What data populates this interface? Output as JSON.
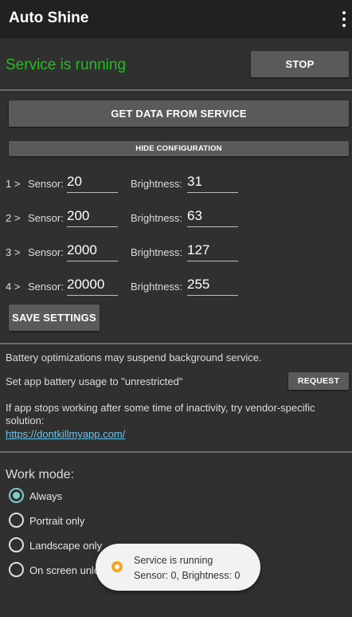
{
  "app_bar": {
    "title": "Auto Shine",
    "menu_icon": "overflow-menu-icon"
  },
  "service": {
    "status": "Service is running",
    "status_color": "#1fbf1f",
    "stop_label": "STOP"
  },
  "actions": {
    "get_data_label": "GET DATA FROM SERVICE",
    "hide_config_label": "HIDE CONFIGURATION",
    "save_label": "SAVE SETTINGS"
  },
  "config": {
    "sensor_label": "Sensor:",
    "brightness_label": "Brightness:",
    "rows": [
      {
        "index": "1 >",
        "sensor": "20",
        "brightness": "31"
      },
      {
        "index": "2 >",
        "sensor": "200",
        "brightness": "63"
      },
      {
        "index": "3 >",
        "sensor": "2000",
        "brightness": "127"
      },
      {
        "index": "4 >",
        "sensor": "20000",
        "brightness": "255"
      }
    ]
  },
  "battery": {
    "warning": "Battery optimizations may suspend background service.",
    "set_usage": "Set app battery usage to \"unrestricted\"",
    "request_label": "REQUEST",
    "vendor_hint": "If app stops working after some time of inactivity, try vendor-specific solution:",
    "link": "https://dontkillmyapp.com/"
  },
  "work_mode": {
    "title": "Work mode:",
    "options": [
      "Always",
      "Portrait only",
      "Landscape only",
      "On screen unlo"
    ],
    "selected": "Always"
  },
  "toast": {
    "line1": "Service is running",
    "line2": "Sensor: 0,  Brightness: 0",
    "icon": "app-icon"
  },
  "colors": {
    "background": "#303030",
    "app_bar": "#212121",
    "button": "#5a5a5a",
    "accent": "#80cbc4",
    "link": "#6ec1e4"
  }
}
